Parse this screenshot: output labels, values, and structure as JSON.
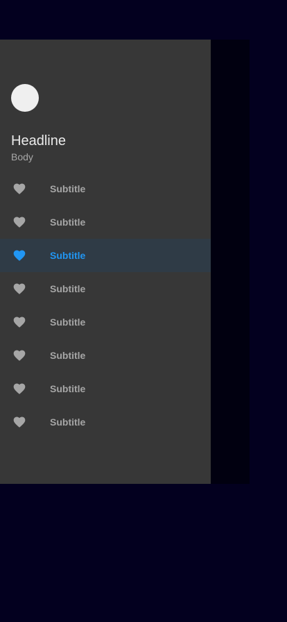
{
  "colors": {
    "background": "#03001f",
    "drawer": "#373737",
    "accent": "#2196f3",
    "icon": "#a6a6a6"
  },
  "drawer": {
    "header": {
      "headline": "Headline",
      "body": "Body"
    },
    "items": [
      {
        "label": "Subtitle",
        "icon": "heart-icon",
        "active": false
      },
      {
        "label": "Subtitle",
        "icon": "heart-icon",
        "active": false
      },
      {
        "label": "Subtitle",
        "icon": "heart-icon",
        "active": true
      },
      {
        "label": "Subtitle",
        "icon": "heart-icon",
        "active": false
      },
      {
        "label": "Subtitle",
        "icon": "heart-icon",
        "active": false
      },
      {
        "label": "Subtitle",
        "icon": "heart-icon",
        "active": false
      },
      {
        "label": "Subtitle",
        "icon": "heart-icon",
        "active": false
      },
      {
        "label": "Subtitle",
        "icon": "heart-icon",
        "active": false
      }
    ]
  }
}
